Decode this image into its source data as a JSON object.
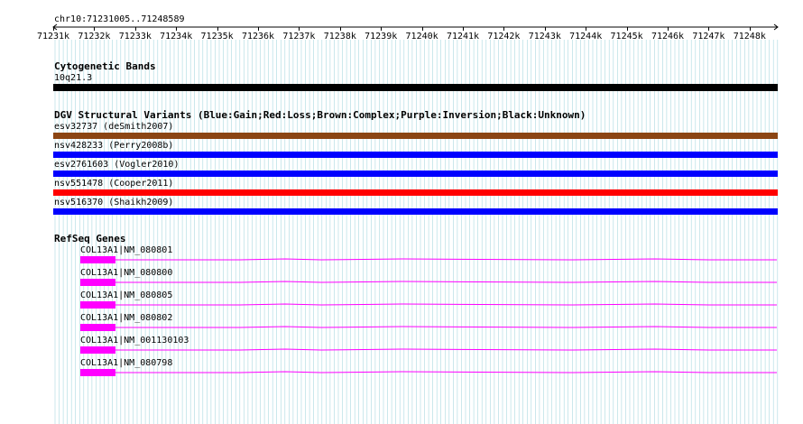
{
  "region": "chr10:71231005..71248589",
  "ruler": {
    "ticks": [
      "71231k",
      "71232k",
      "71233k",
      "71234k",
      "71235k",
      "71236k",
      "71237k",
      "71238k",
      "71239k",
      "71240k",
      "71241k",
      "71242k",
      "71243k",
      "71244k",
      "71245k",
      "71246k",
      "71247k",
      "71248k"
    ]
  },
  "cytobands": {
    "title": "Cytogenetic Bands",
    "band": "10q21.3",
    "color": "#000000"
  },
  "dgv": {
    "title": "DGV Structural Variants (Blue:Gain;Red:Loss;Brown:Complex;Purple:Inversion;Black:Unknown)",
    "variants": [
      {
        "label": "esv32737 (deSmith2007)",
        "color": "#8b4513"
      },
      {
        "label": "nsv428233 (Perry2008b)",
        "color": "#0000ff"
      },
      {
        "label": "esv2761603 (Vogler2010)",
        "color": "#0000ff"
      },
      {
        "label": "nsv551478 (Cooper2011)",
        "color": "#ff0000"
      },
      {
        "label": "nsv516370 (Shaikh2009)",
        "color": "#0000ff"
      }
    ]
  },
  "refseq": {
    "title": "RefSeq Genes",
    "color": "#ff00ff",
    "transcripts": [
      {
        "label": "COL13A1|NM_080801"
      },
      {
        "label": "COL13A1|NM_080800"
      },
      {
        "label": "COL13A1|NM_080805"
      },
      {
        "label": "COL13A1|NM_080802"
      },
      {
        "label": "COL13A1|NM_001130103"
      },
      {
        "label": "COL13A1|NM_080798"
      }
    ]
  },
  "colors": {
    "grid": "#a9d8e0",
    "ruler": "#000000"
  }
}
